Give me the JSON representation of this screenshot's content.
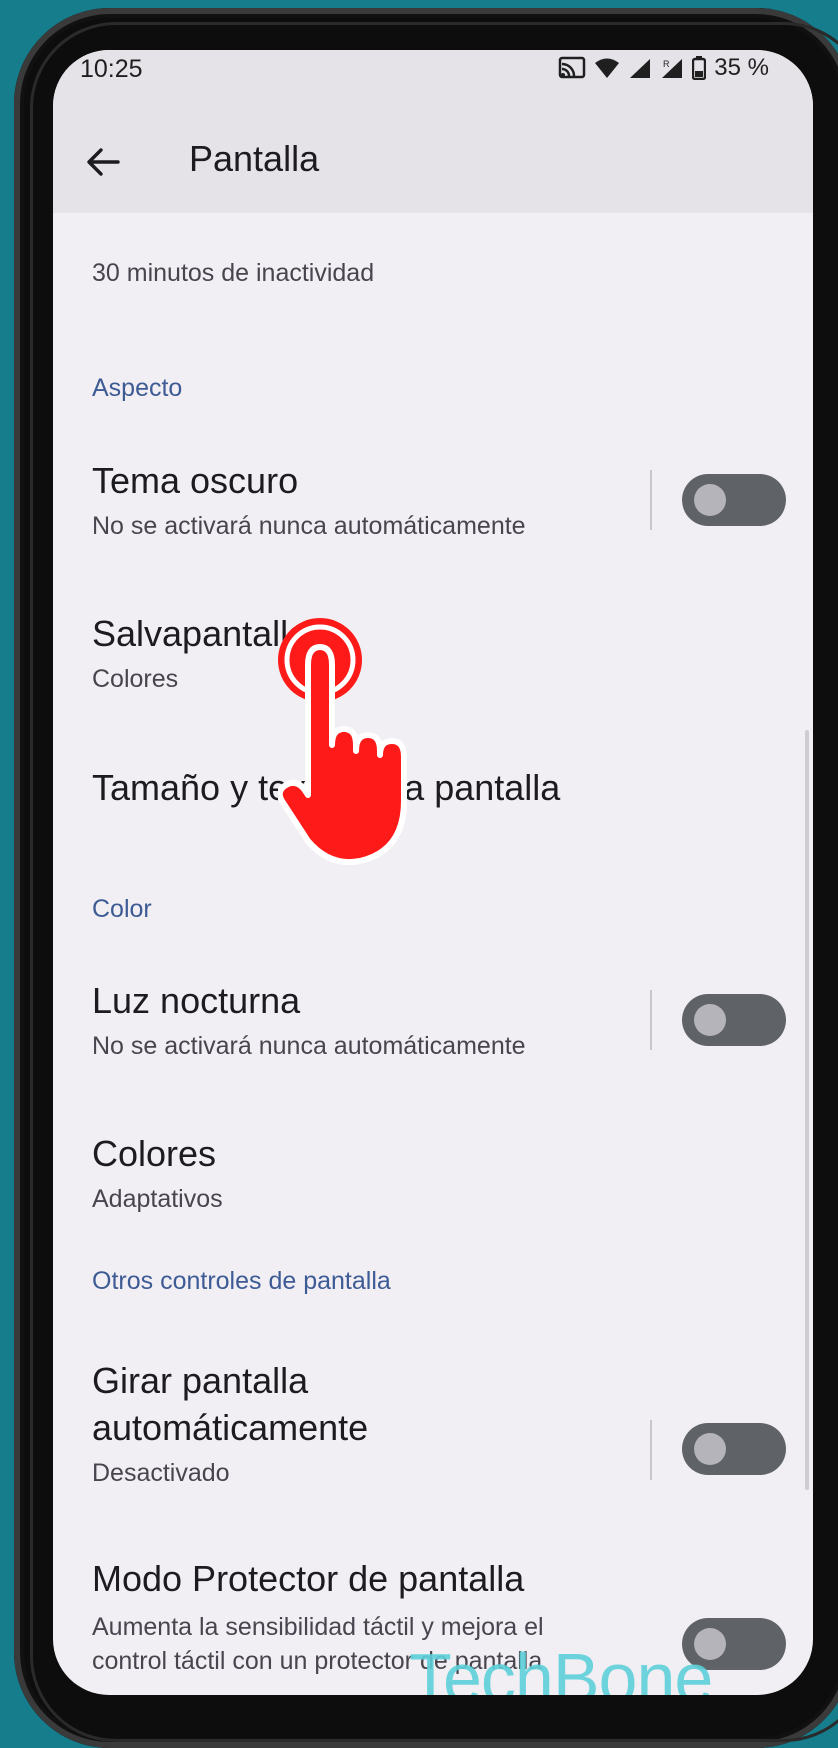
{
  "status_bar": {
    "time": "10:25",
    "battery": "35 %",
    "icons": [
      "cast-icon",
      "wifi-icon",
      "signal-icon",
      "signal-roaming-icon",
      "battery-icon"
    ]
  },
  "header": {
    "title": "Pantalla",
    "back_icon": "arrow-left-icon"
  },
  "content": {
    "timeout_summary": "30 minutos de inactividad",
    "sections": [
      {
        "header": "Aspecto",
        "items": [
          {
            "title": "Tema oscuro",
            "subtitle": "No se activará nunca automáticamente",
            "toggle": false
          },
          {
            "title": "Salvapantallas",
            "subtitle": "Colores"
          },
          {
            "title": "Tamaño y texto de la pantalla"
          }
        ]
      },
      {
        "header": "Color",
        "items": [
          {
            "title": "Luz nocturna",
            "subtitle": "No se activará nunca automáticamente",
            "toggle": false
          },
          {
            "title": "Colores",
            "subtitle": "Adaptativos"
          }
        ]
      },
      {
        "header": "Otros controles de pantalla",
        "items": [
          {
            "title_line1": "Girar pantalla",
            "title_line2": "automáticamente",
            "subtitle": "Desactivado",
            "toggle": false
          },
          {
            "title": "Modo Protector de pantalla",
            "subtitle_line1": "Aumenta la sensibilidad táctil y mejora el",
            "subtitle_line2": "control táctil con un protector de pantalla",
            "toggle": false
          }
        ]
      }
    ]
  },
  "watermark": "TechBone",
  "colors": {
    "background": "#157d8c",
    "screen": "#f2eff4",
    "header": "#e6e3e8",
    "section_header": "#3d5b94",
    "toggle_off": "#5f6368",
    "tap_hand": "#ff1a1a"
  }
}
